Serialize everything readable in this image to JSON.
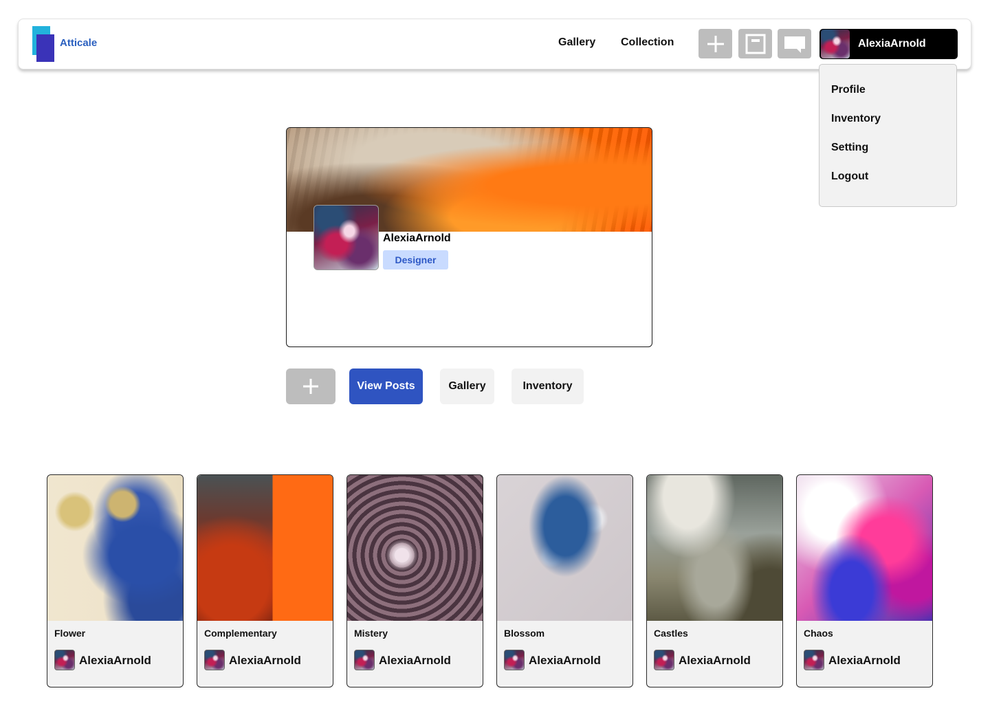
{
  "header": {
    "brand": "Atticale",
    "nav": [
      "Gallery",
      "Collection"
    ],
    "icons": [
      "plus-icon",
      "frame-icon",
      "chat-icon"
    ],
    "user_name": "AlexiaArnold"
  },
  "dropdown": {
    "items": [
      "Profile",
      "Inventory",
      "Setting",
      "Logout"
    ]
  },
  "profile": {
    "name": "AlexiaArnold",
    "role": "Designer"
  },
  "actions": {
    "view_posts": "View Posts",
    "gallery": "Gallery",
    "inventory": "Inventory"
  },
  "posts": [
    {
      "title": "Flower",
      "author": "AlexiaArnold"
    },
    {
      "title": "Complementary",
      "author": "AlexiaArnold"
    },
    {
      "title": "Mistery",
      "author": "AlexiaArnold"
    },
    {
      "title": "Blossom",
      "author": "AlexiaArnold"
    },
    {
      "title": "Castles",
      "author": "AlexiaArnold"
    },
    {
      "title": "Chaos",
      "author": "AlexiaArnold"
    }
  ],
  "colors": {
    "brand": "#2a5fbf",
    "primary_button": "#2f54c1",
    "badge_bg": "#c9dbff",
    "icon_button": "#bdbdbd"
  }
}
